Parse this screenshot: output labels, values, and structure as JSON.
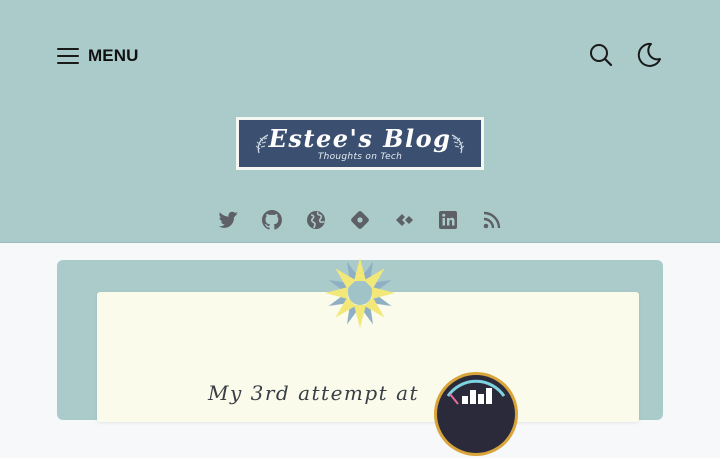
{
  "header": {
    "menu_label": "MENU",
    "icons": [
      "hamburger-icon",
      "search-icon",
      "moon-icon"
    ]
  },
  "logo": {
    "title": "Estee's Blog",
    "subtitle": "Thoughts on Tech"
  },
  "social_icons": [
    "twitter-icon",
    "github-icon",
    "globe-icon",
    "tag-icon",
    "gitee-icon",
    "linkedin-icon",
    "rss-icon"
  ],
  "featured": {
    "title": "My 3rd attempt at"
  },
  "colors": {
    "header_bg": "#aacbca",
    "logo_bg": "#3b5070",
    "paper_bg": "#fafbea",
    "icon_gray": "#5d6066",
    "flower_yellow": "#f2e87a",
    "flower_petal_blue": "#8fb0c4"
  }
}
